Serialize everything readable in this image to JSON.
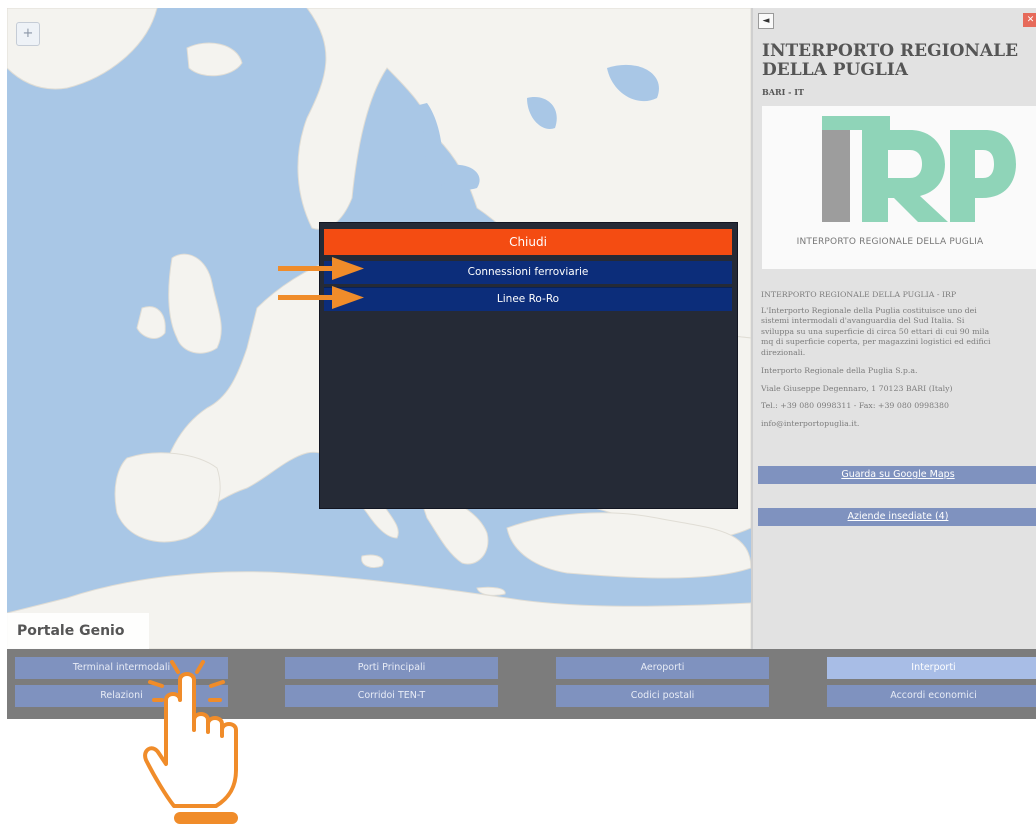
{
  "map": {
    "zoom_label": "+",
    "portal_title": "Portale Genio"
  },
  "popup": {
    "close_label": "Chiudi",
    "items": [
      "Connessioni ferroviarie",
      "Linee Ro-Ro"
    ]
  },
  "panel": {
    "back_icon": "◄",
    "close_icon": "✕",
    "title": "INTERPORTO REGIONALE DELLA PUGLIA",
    "subtitle": "BARI - IT",
    "logo_text": "IRP",
    "logo_caption": "INTERPORTO REGIONALE DELLA PUGLIA",
    "info_heading": "INTERPORTO REGIONALE DELLA PUGLIA - IRP",
    "description_lines": [
      "L'Interporto Regionale della Puglia costituisce uno dei",
      "sistemi intermodali d'avanguardia del Sud Italia. Si",
      "sviluppa su una superficie di circa 50 ettari di cui 90 mila",
      "mq di superficie coperta, per magazzini logistici ed edifici",
      "direzionali."
    ],
    "company": "Interporto Regionale della Puglia S.p.a.",
    "address": "Viale Giuseppe Degennaro, 1 70123 BARI (Italy)",
    "phone": "Tel.: +39 080 0998311 - Fax: +39 080 0998380",
    "email": "info@interportopuglia.it.",
    "maps_button": "Guarda su Google Maps",
    "companies_button": "Aziende insediate (4)"
  },
  "nav": {
    "row1": [
      "Terminal intermodali",
      "Porti Principali",
      "Aeroporti",
      "Interporti"
    ],
    "row2": [
      "Relazioni",
      "Corridoi TEN-T",
      "Codici postali",
      "Accordi economici"
    ],
    "active": "Interporti"
  },
  "colors": {
    "sea": "#a9c7e6",
    "land": "#f4f3ef",
    "popup_close": "#f44c12",
    "popup_item": "#0c2d7a",
    "nav_button": "#7f92bf",
    "nav_active": "#a8bde6",
    "arrow": "#f08c2a",
    "logo_gray": "#9d9d9d",
    "logo_teal": "#8fd4b8"
  }
}
